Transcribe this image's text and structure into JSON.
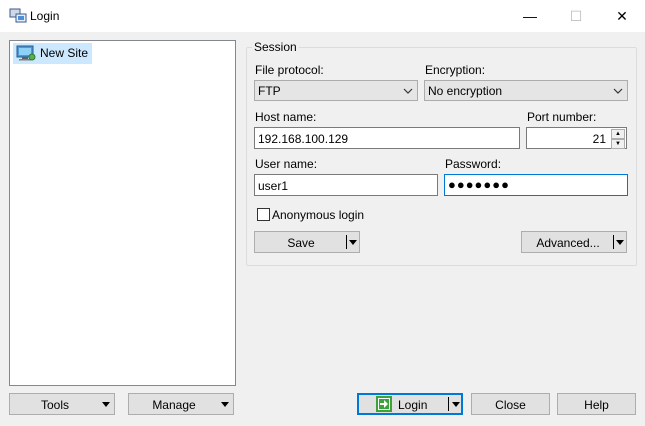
{
  "window": {
    "title": "Login",
    "minimize_glyph": "—",
    "maximize_glyph": "☐",
    "close_glyph": "✕"
  },
  "sites": {
    "items": [
      {
        "label": "New Site",
        "icon": "computer-icon"
      }
    ]
  },
  "session": {
    "legend": "Session",
    "file_protocol_label": "File protocol:",
    "file_protocol_value": "FTP",
    "encryption_label": "Encryption:",
    "encryption_value": "No encryption",
    "host_label": "Host name:",
    "host_value": "192.168.100.129",
    "port_label": "Port number:",
    "port_value": "21",
    "user_label": "User name:",
    "user_value": "user1",
    "password_label": "Password:",
    "password_value": "●●●●●●●",
    "anonymous_label": "Anonymous login",
    "save_label": "Save",
    "advanced_label": "Advanced..."
  },
  "footer": {
    "tools_label": "Tools",
    "manage_label": "Manage",
    "login_label": "Login",
    "close_label": "Close",
    "help_label": "Help"
  },
  "colors": {
    "accent": "#0078d7",
    "selection": "#cce8ff",
    "login_icon": "#3aa33a"
  }
}
